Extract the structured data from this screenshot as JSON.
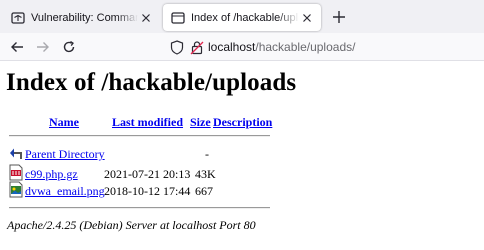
{
  "browser": {
    "tabs": [
      {
        "title": "Vulnerability: Command Injection",
        "active": false
      },
      {
        "title": "Index of /hackable/uploads",
        "active": true
      }
    ],
    "url": {
      "host": "localhost",
      "path": "/hackable/uploads/"
    }
  },
  "page": {
    "heading": "Index of /hackable/uploads",
    "columns": {
      "name": "Name",
      "modified": "Last modified",
      "size": "Size",
      "description": "Description"
    },
    "parent": {
      "name": "Parent Directory",
      "size": "-",
      "icon": "back-icon"
    },
    "files": [
      {
        "name": "c99.php.gz",
        "modified": "2021-07-21 20:13",
        "size": "43K",
        "icon": "compressed-file-icon"
      },
      {
        "name": "dvwa_email.png",
        "modified": "2018-10-12 17:44",
        "size": "667",
        "icon": "image-file-icon"
      }
    ],
    "address": "Apache/2.4.25 (Debian) Server at localhost Port 80"
  },
  "colors": {
    "link": "#0000ee",
    "tabbar": "#f0f0f4",
    "navbar": "#f9f9fb"
  }
}
